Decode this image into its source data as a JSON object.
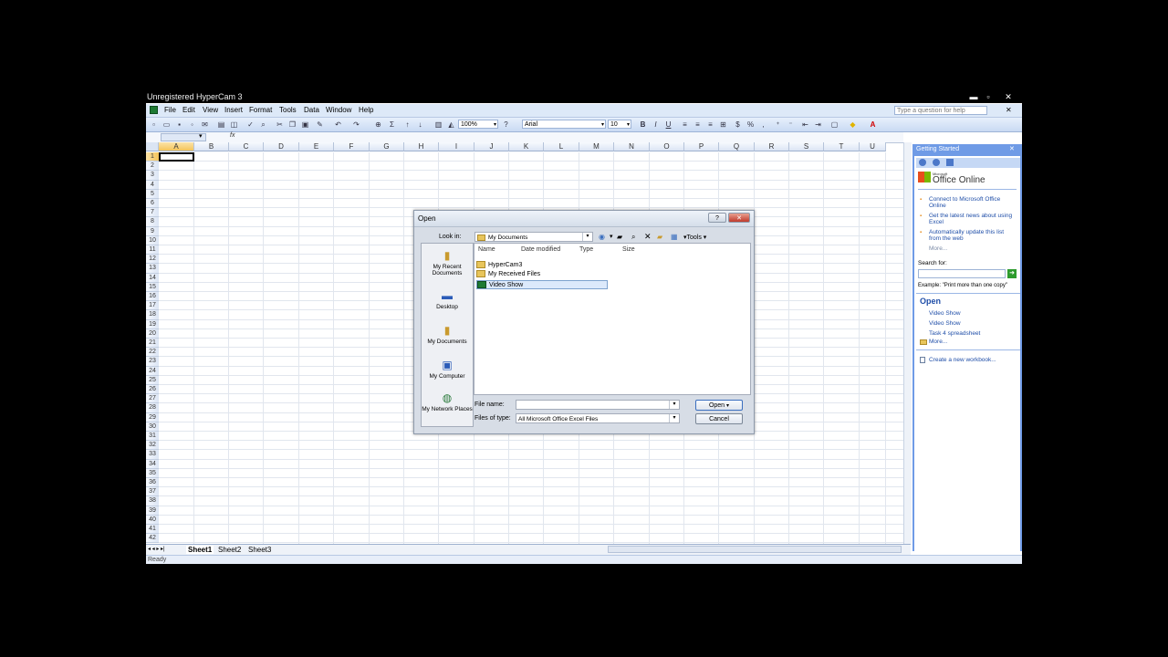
{
  "window": {
    "title": "Unregistered HyperCam 3",
    "min_glyph": "▬",
    "max_glyph": "▫",
    "close_glyph": "✕"
  },
  "menu": {
    "items": [
      "File",
      "Edit",
      "View",
      "Insert",
      "Format",
      "Tools",
      "Data",
      "Window",
      "Help"
    ],
    "help_placeholder": "Type a question for help",
    "close_glyph": "✕"
  },
  "toolbar": {
    "zoom": "100%",
    "font": "Arial",
    "size": "10",
    "bold": "B",
    "italic": "I",
    "underline": "U",
    "sum": "Σ",
    "percent": "%"
  },
  "formula_bar": {
    "fx": "fx"
  },
  "grid": {
    "columns": [
      "A",
      "B",
      "C",
      "D",
      "E",
      "F",
      "G",
      "H",
      "I",
      "J",
      "K",
      "L",
      "M",
      "N",
      "O",
      "P",
      "Q",
      "R",
      "S",
      "T",
      "U"
    ],
    "rows": [
      "1",
      "2",
      "3",
      "4",
      "5",
      "6",
      "7",
      "8",
      "9",
      "10",
      "11",
      "12",
      "13",
      "14",
      "15",
      "16",
      "17",
      "18",
      "19",
      "20",
      "21",
      "22",
      "23",
      "24",
      "25",
      "26",
      "27",
      "28",
      "29",
      "30",
      "31",
      "32",
      "33",
      "34",
      "35",
      "36",
      "37",
      "38",
      "39",
      "40",
      "41",
      "42"
    ]
  },
  "sheets": {
    "tabs": [
      "Sheet1",
      "Sheet2",
      "Sheet3"
    ],
    "nav": "◂ ◂ ▸ ▸|"
  },
  "status": {
    "text": "Ready"
  },
  "task_pane": {
    "title": "Getting Started",
    "brand_small": "Microsoft",
    "brand": "Office Online",
    "links": [
      "Connect to Microsoft Office Online",
      "Get the latest news about using Excel",
      "Automatically update this list from the web"
    ],
    "more1": "More...",
    "search_label": "Search for:",
    "example": "Example: \"Print more than one copy\"",
    "open_heading": "Open",
    "open_files": [
      "Video Show",
      "Video Show",
      "Task 4 spreadsheet"
    ],
    "more2": "More...",
    "new_workbook": "Create a new workbook..."
  },
  "dialog": {
    "title": "Open",
    "help_glyph": "?",
    "close_glyph": "✕",
    "look_in_label": "Look in:",
    "look_in_value": "My Documents",
    "tools_label": "Tools",
    "places": [
      "My Recent Documents",
      "Desktop",
      "My Documents",
      "My Computer",
      "My Network Places"
    ],
    "columns": [
      "Name",
      "Date modified",
      "Type",
      "Size"
    ],
    "files": [
      "HyperCam3",
      "My Received Files",
      "Video Show"
    ],
    "file_name_label": "File name:",
    "file_name_value": "",
    "files_of_type_label": "Files of type:",
    "files_of_type_value": "All Microsoft Office Excel Files",
    "open_button": "Open",
    "cancel_button": "Cancel"
  }
}
